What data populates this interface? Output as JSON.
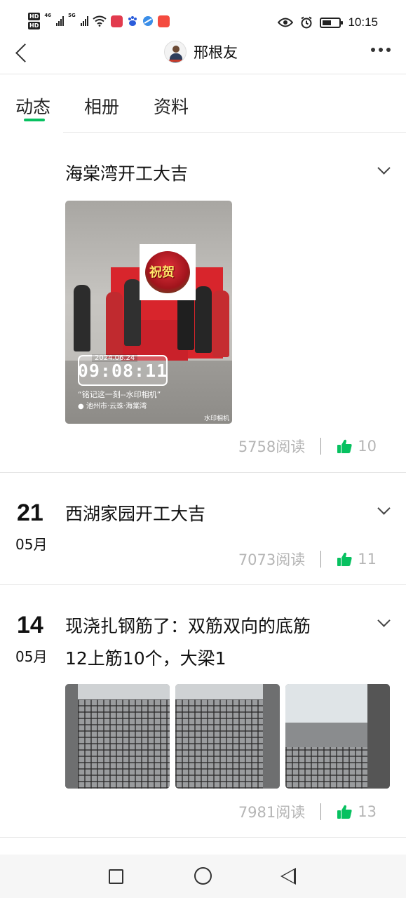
{
  "status_bar": {
    "time": "10:15",
    "hd_badges": [
      "HD",
      "HD"
    ],
    "network_labels": [
      "46",
      "5G"
    ],
    "icons": [
      "signal-icon",
      "wifi-icon",
      "app-icon",
      "baidu-icon",
      "browser-icon",
      "app-icon",
      "eye-icon",
      "alarm-icon",
      "battery-icon"
    ]
  },
  "header": {
    "title": "邢根友",
    "back_icon": "chevron-left-icon",
    "more_icon": "more-dots-icon"
  },
  "tabs": [
    {
      "label": "动态",
      "active": true
    },
    {
      "label": "相册",
      "active": false
    },
    {
      "label": "资料",
      "active": false
    }
  ],
  "accent_color": "#07c160",
  "posts": [
    {
      "day": "",
      "month": "",
      "title": "海棠湾开工大吉",
      "reads": "5758阅读",
      "likes": "10",
      "photo_watermark": {
        "date": "2024.06.24",
        "time": "09:08:11",
        "slogan": "“铭记这一刻--水印相机”",
        "location": "池州市·云珠·海棠湾",
        "brand": "水印相机",
        "flower_text": "祝贺"
      }
    },
    {
      "day": "21",
      "month": "05月",
      "title": "西湖家园开工大吉",
      "reads": "7073阅读",
      "likes": "11"
    },
    {
      "day": "14",
      "month": "05月",
      "title": "现浇扎钢筋了：双筋双向的底筋12上筋10个，大梁1",
      "reads": "7981阅读",
      "likes": "13"
    }
  ],
  "nav_bar": {
    "icons": [
      "square-icon",
      "circle-icon",
      "triangle-back-icon"
    ]
  }
}
